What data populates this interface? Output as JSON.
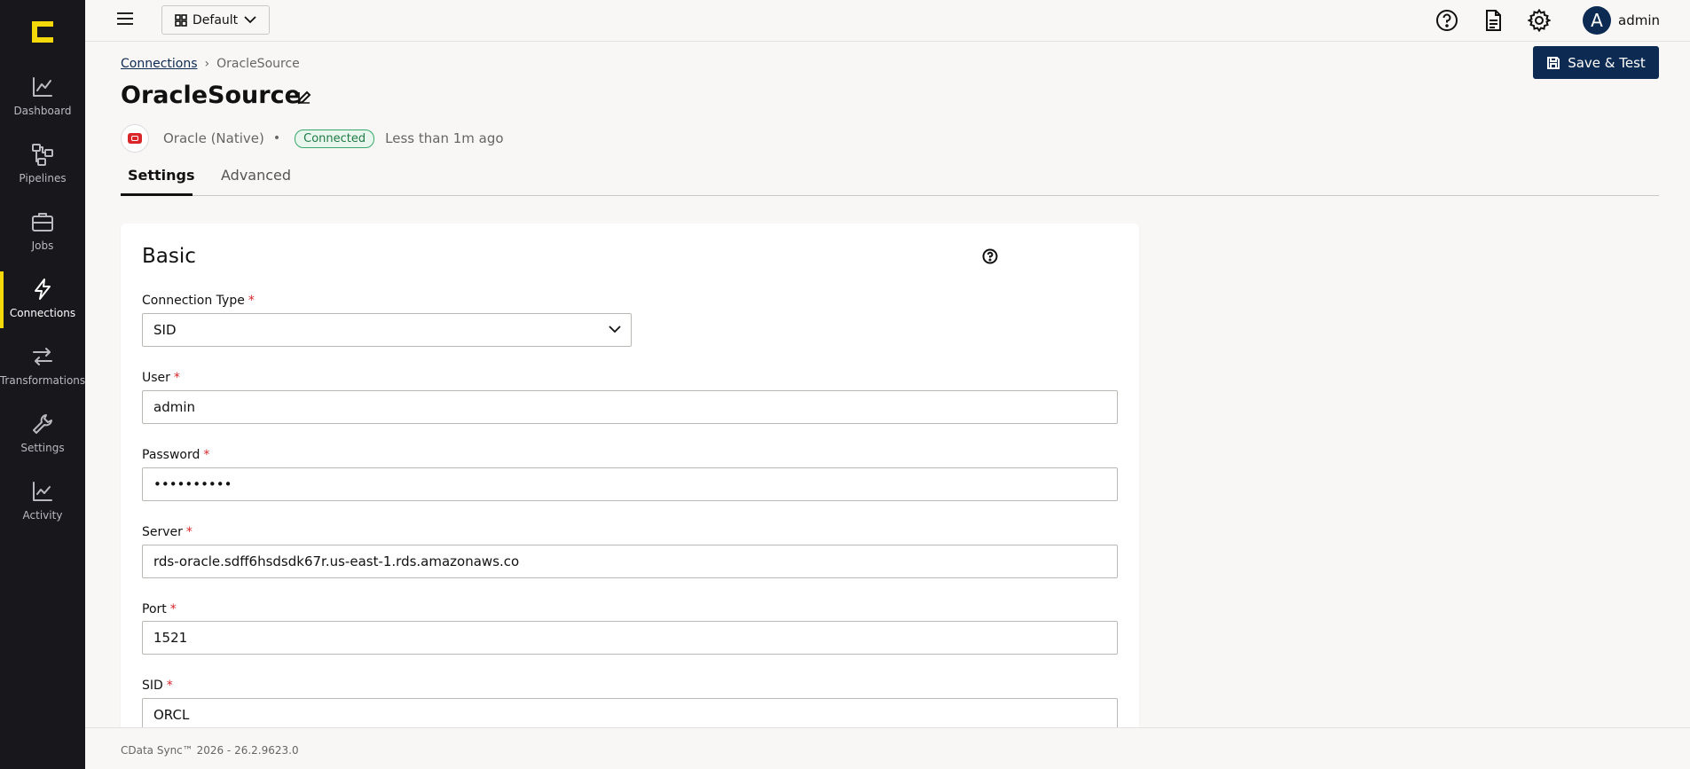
{
  "sidebar": {
    "items": [
      {
        "label": "Dashboard",
        "icon": "chart-line-icon"
      },
      {
        "label": "Pipelines",
        "icon": "pipeline-nodes-icon"
      },
      {
        "label": "Jobs",
        "icon": "briefcase-icon"
      },
      {
        "label": "Connections",
        "icon": "lightning-icon",
        "active": true
      },
      {
        "label": "Transformations",
        "icon": "arrows-swap-icon"
      },
      {
        "label": "Settings",
        "icon": "wrench-icon"
      },
      {
        "label": "Activity",
        "icon": "activity-chart-icon"
      }
    ]
  },
  "topbar": {
    "dashboard_select": "Default",
    "username": "admin",
    "avatar_initial": "A"
  },
  "breadcrumb": {
    "parent": "Connections",
    "current": "OracleSource"
  },
  "header": {
    "title": "OracleSource",
    "save_label": "Save & Test",
    "driver": "Oracle (Native)",
    "status": "Connected",
    "status_color": "#38a86a",
    "last_tested": "Less than 1m ago"
  },
  "tabs": [
    {
      "label": "Settings",
      "active": true
    },
    {
      "label": "Advanced",
      "active": false
    }
  ],
  "card": {
    "title": "Basic",
    "fields": {
      "connection_type": {
        "label": "Connection Type",
        "value": "SID"
      },
      "user": {
        "label": "User",
        "value": "admin"
      },
      "password": {
        "label": "Password",
        "value": "••••••••••"
      },
      "server": {
        "label": "Server",
        "value": "rds-oracle.sdff6hsdsdk67r.us-east-1.rds.amazonaws.co"
      },
      "port": {
        "label": "Port",
        "value": "1521"
      },
      "sid": {
        "label": "SID",
        "value": "ORCL"
      }
    }
  },
  "footer": {
    "text": "CData Sync™ 2026 - 26.2.9623.0"
  },
  "colors": {
    "sidebar_bg": "#17171c",
    "accent_yellow": "#f5d90a",
    "primary_navy": "#0d2a52",
    "required_red": "#d8262b"
  }
}
